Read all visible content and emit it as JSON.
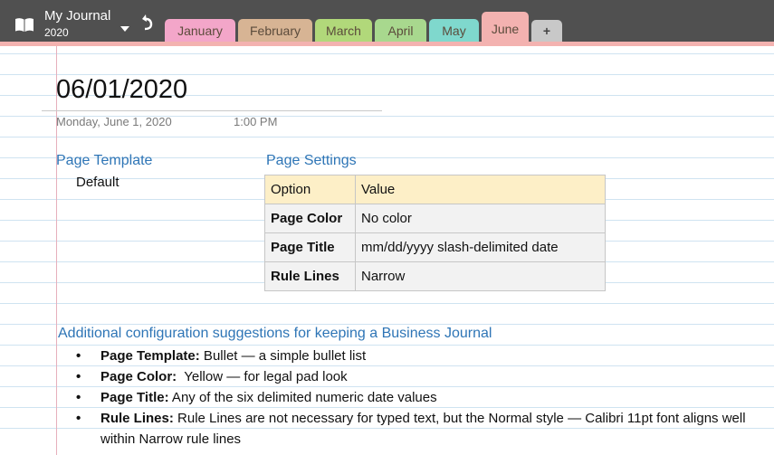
{
  "header": {
    "notebook_name": "My Journal",
    "section_group": "2020",
    "tabs": [
      {
        "label": "January",
        "color": "#f3a6c9"
      },
      {
        "label": "February",
        "color": "#d7b494"
      },
      {
        "label": "March",
        "color": "#b1d87a"
      },
      {
        "label": "April",
        "color": "#a8d88e"
      },
      {
        "label": "May",
        "color": "#7fd8cd"
      }
    ],
    "active_tab": {
      "label": "June",
      "color": "#f3b2b0"
    },
    "add_tab_label": "+",
    "icons": {
      "notebook": "notebook-icon",
      "dropdown": "chevron-down-icon",
      "back": "back-arrow-icon"
    }
  },
  "page": {
    "title": "06/01/2020",
    "date": "Monday, June 1, 2020",
    "time": "1:00 PM",
    "template_heading": "Page Template",
    "template_value": "Default",
    "settings_heading": "Page Settings",
    "settings_table": {
      "headers": [
        "Option",
        "Value"
      ],
      "rows": [
        [
          "Page Color",
          "No color"
        ],
        [
          "Page Title",
          "mm/dd/yyyy slash-delimited date"
        ],
        [
          "Rule Lines",
          "Narrow"
        ]
      ]
    },
    "suggestions_heading": "Additional configuration suggestions for keeping a Business Journal",
    "suggestions": [
      {
        "label": "Page Template:",
        "text": " Bullet — a simple bullet list"
      },
      {
        "label": "Page Color:",
        "text": "  Yellow — for legal pad look"
      },
      {
        "label": "Page Title:",
        "text": " Any of the six delimited numeric date values"
      },
      {
        "label": "Rule Lines:",
        "text": " Rule Lines are not necessary for typed text, but the Normal style — Calibri 11pt font aligns well within Narrow rule lines"
      }
    ],
    "bullet_char": "•"
  },
  "colors": {
    "toolbar": "#505050",
    "accent": "#f3b2b0",
    "heading": "#2e75b6",
    "rule_line": "#cfe3f1",
    "margin_line": "#e6b0bc",
    "table_header": "#fdefc7",
    "table_row": "#f2f2f2"
  }
}
